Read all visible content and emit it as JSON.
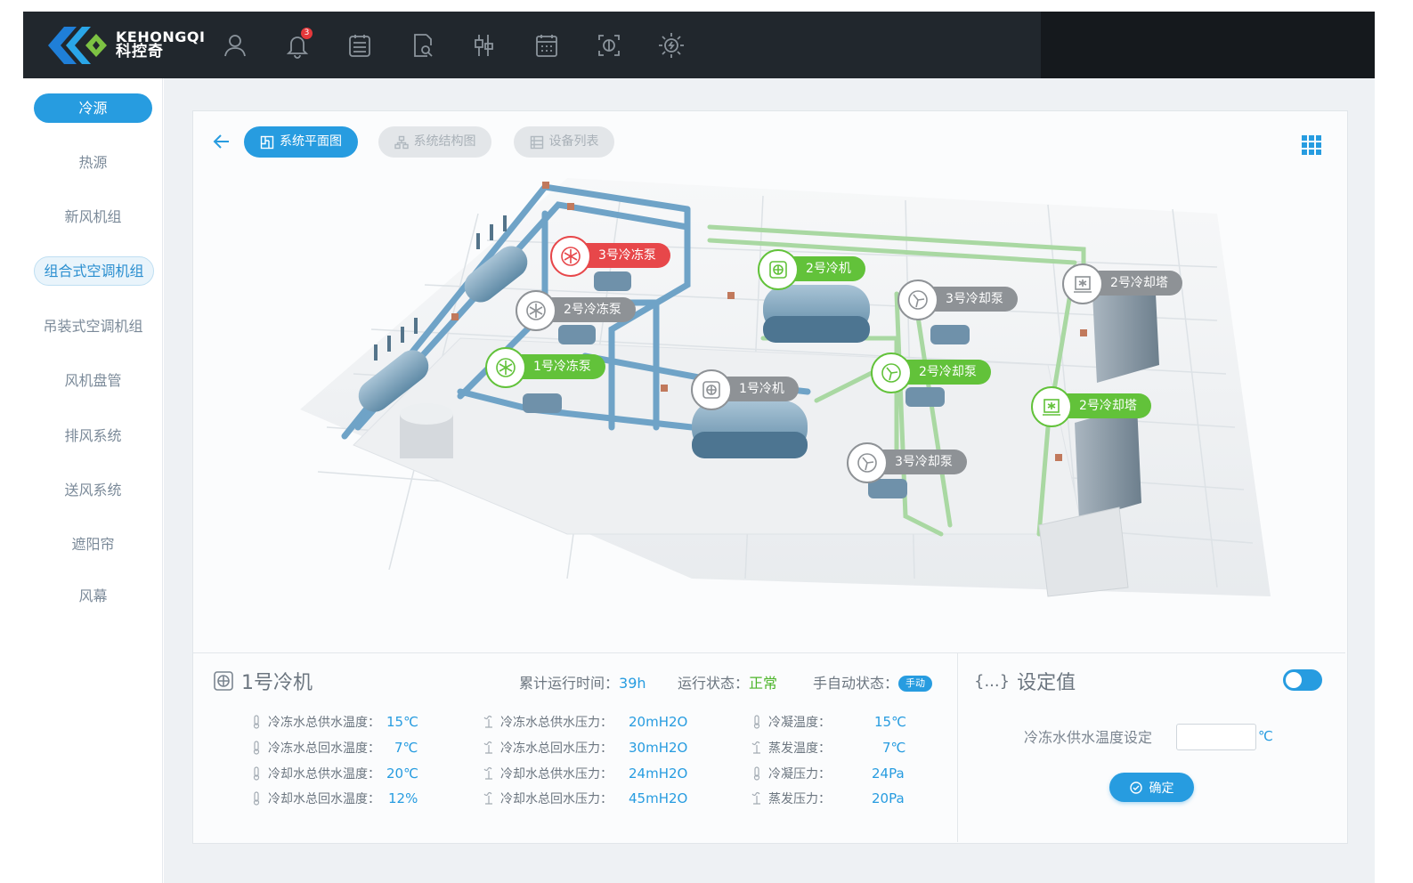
{
  "brand": {
    "name_en": "KEHONGQI",
    "name_cn": "科控奇"
  },
  "header": {
    "notification_count": "3",
    "icons": [
      "user-icon",
      "bell-icon",
      "clipboard-icon",
      "document-search-icon",
      "tools-icon",
      "calendar-icon",
      "scan-icon",
      "sun-icon"
    ]
  },
  "sidebar": {
    "items": [
      {
        "label": "冷源"
      },
      {
        "label": "热源"
      },
      {
        "label": "新风机组"
      },
      {
        "label": "组合式空调机组"
      },
      {
        "label": "吊装式空调机组"
      },
      {
        "label": "风机盘管"
      },
      {
        "label": "排风系统"
      },
      {
        "label": "送风系统"
      },
      {
        "label": "遮阳帘"
      },
      {
        "label": "风幕"
      }
    ],
    "active_index": 0
  },
  "tabs": [
    {
      "label": "系统平面图",
      "active": true
    },
    {
      "label": "系统结构图",
      "active": false
    },
    {
      "label": "设备列表",
      "active": false
    }
  ],
  "schematic": {
    "labels": [
      {
        "text": "3号冷冻泵",
        "status": "alarm"
      },
      {
        "text": "2号冷冻泵",
        "status": "off"
      },
      {
        "text": "1号冷冻泵",
        "status": "running"
      },
      {
        "text": "2号冷机",
        "status": "running"
      },
      {
        "text": "1号冷机",
        "status": "off"
      },
      {
        "text": "3号冷却泵",
        "status": "off"
      },
      {
        "text": "2号冷却泵",
        "status": "running"
      },
      {
        "text": "3号冷却泵",
        "status": "off"
      },
      {
        "text": "2号冷却塔",
        "status": "off"
      },
      {
        "text": "2号冷却塔",
        "status": "running"
      }
    ],
    "colors": {
      "alarm": "#e7474a",
      "running": "#62c23a",
      "off": "#8e9296",
      "pipe_chilled": "#6fa3c7",
      "pipe_cooling": "#a9d8a2"
    }
  },
  "device_panel": {
    "title": "1号冷机",
    "runtime_label": "累计运行时间：",
    "runtime_value": "39h",
    "state_label": "运行状态：",
    "state_value": "正常",
    "mode_label": "手自动状态：",
    "mode_value": "手动",
    "params_col1": [
      {
        "label": "冷冻水总供水温度：",
        "value": "15℃"
      },
      {
        "label": "冷冻水总回水温度：",
        "value": "7℃"
      },
      {
        "label": "冷却水总供水温度：",
        "value": "20℃"
      },
      {
        "label": "冷却水总回水温度：",
        "value": "12%"
      }
    ],
    "params_col2": [
      {
        "label": "冷冻水总供水压力：",
        "value": "20mH2O"
      },
      {
        "label": "冷冻水总回水压力：",
        "value": "30mH2O"
      },
      {
        "label": "冷却水总供水压力：",
        "value": "24mH2O"
      },
      {
        "label": "冷却水总回水压力：",
        "value": "45mH2O"
      }
    ],
    "params_col3": [
      {
        "label": "冷凝温度：",
        "value": "15℃"
      },
      {
        "label": "蒸发温度：",
        "value": "7℃"
      },
      {
        "label": "冷凝压力：",
        "value": "24Pa"
      },
      {
        "label": "蒸发压力：",
        "value": "20Pa"
      }
    ]
  },
  "setpoint_panel": {
    "title": "设定值",
    "title_icon_text": "{...}",
    "field_label": "冷冻水供水温度设定",
    "field_value": "",
    "unit": "℃",
    "confirm_label": "确定",
    "toggle_on": true
  },
  "accent": "#279ce0"
}
